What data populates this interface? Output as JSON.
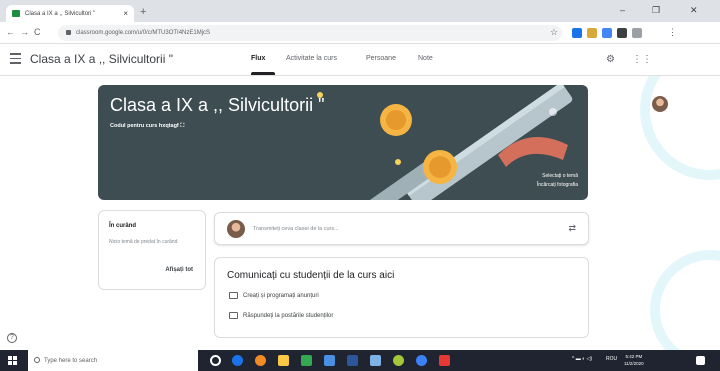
{
  "browser": {
    "tab_title": "Clasa a IX a ,, Silvicultori \"",
    "tab_close": "×",
    "new_tab": "+",
    "url": "classroom.google.com/u/0/c/MTU3OTI4NzE1MjcS",
    "window_controls": [
      "–",
      "❐",
      "✕"
    ]
  },
  "header": {
    "course_title": "Clasa a IX a ,, Silvicultorii \"",
    "tabs": [
      "Flux",
      "Activitate la curs",
      "Persoane",
      "Note"
    ]
  },
  "banner": {
    "title": "Clasa a IX a ,, Silvicultorii \"",
    "class_code_label": "Codul pentru curs",
    "class_code": "hxqtagf",
    "select_theme": "Selectați o temă",
    "upload_photo": "Încărcați fotografia",
    "colors": {
      "background": "#3d4d52",
      "medal": "#f6b443"
    }
  },
  "upcoming": {
    "heading": "În curând",
    "empty_text": "Nicio temă de predat în curând",
    "view_all": "Afișați tot"
  },
  "post": {
    "placeholder": "Transmiteți ceva clasei de la curs..."
  },
  "communicate": {
    "heading": "Comunicați cu studenții de la curs aici",
    "items": [
      "Creați și programați anunțuri",
      "Răspundeți la postările studenților"
    ]
  },
  "taskbar": {
    "search_placeholder": "Type here to search",
    "language": "ROU",
    "time": "5:42 PM",
    "date": "11/2/2020"
  }
}
